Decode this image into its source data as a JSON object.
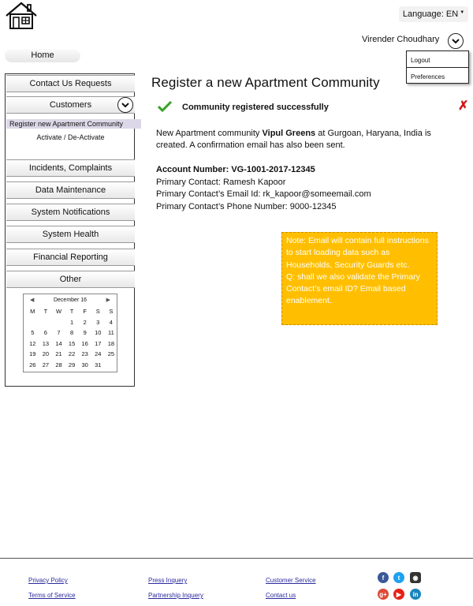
{
  "header": {
    "language_label": "Language: EN",
    "user_name": "Virender Choudhary",
    "user_menu": [
      "Logout",
      "Preferences"
    ]
  },
  "nav": {
    "home": "Home",
    "items": [
      "Contact Us Requests",
      "Customers",
      "Incidents, Complaints",
      "Data Maintenance",
      "System Notifications",
      "System Health",
      "Financial Reporting",
      "Other"
    ],
    "customers_sub": [
      "Register new Apartment Community",
      "Activate / De-Activate"
    ]
  },
  "calendar": {
    "month": "December 16",
    "weekdays": [
      "M",
      "T",
      "W",
      "T",
      "F",
      "S",
      "S"
    ],
    "days": [
      "",
      "",
      "",
      "1",
      "2",
      "3",
      "4",
      "5",
      "6",
      "7",
      "8",
      "9",
      "10",
      "11",
      "12",
      "13",
      "14",
      "15",
      "16",
      "17",
      "18",
      "19",
      "20",
      "21",
      "22",
      "23",
      "24",
      "25",
      "26",
      "27",
      "28",
      "29",
      "30",
      "31",
      ""
    ]
  },
  "main": {
    "title": "Register a new Apartment Community",
    "success": "Community registered successfully",
    "message_prefix": "New Apartment community ",
    "community_name": "Vipul Greens",
    "message_suffix": " at Gurgoan, Haryana, India is created. A confirmation email has also been sent.",
    "account_number": "Account Number: VG-1001-2017-12345",
    "primary_contact": "Primary Contact: Ramesh Kapoor",
    "primary_email": "Primary Contact’s Email Id:  rk_kapoor@someemail.com",
    "primary_phone": "Primary Contact’s Phone Number: 9000-12345"
  },
  "note": {
    "text": "Note: Email will contain full instructions to start loading data such as Households, Security Guards etc.",
    "question": "Q: shall we also validate the Primary Contact’s email ID? Email based enablement."
  },
  "footer": {
    "links": [
      "Privacy Policy",
      "Terms of Service",
      "Press Inquery",
      "Partnership Inquery",
      "Customer Service",
      "Contact us"
    ],
    "social": [
      "facebook-icon",
      "twitter-icon",
      "instagram-icon",
      "google-plus-icon",
      "youtube-icon",
      "linkedin-icon"
    ]
  },
  "colors": {
    "note_bg": "#ffbf00",
    "success_check": "#3aa02a",
    "close_red": "#d01818",
    "selected_sub": "#ddd8e8",
    "link": "#2a2aa0"
  }
}
